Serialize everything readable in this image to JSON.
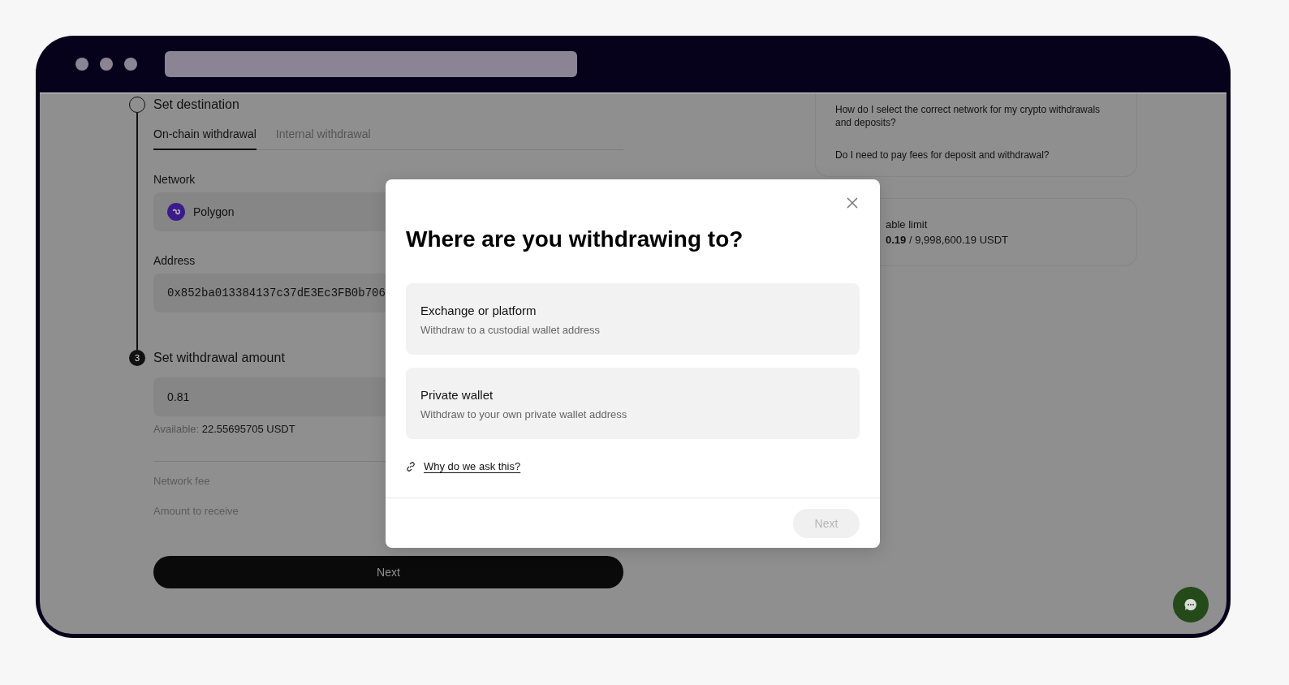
{
  "destination": {
    "title": "Set destination",
    "tabs": [
      {
        "label": "On-chain withdrawal",
        "selected": true
      },
      {
        "label": "Internal withdrawal",
        "selected": false
      }
    ],
    "network": {
      "label": "Network",
      "value": "Polygon"
    },
    "address": {
      "label": "Address",
      "value": "0x852ba013384137c37dE3Ec3FB0b706"
    }
  },
  "amount": {
    "step": "3",
    "title": "Set withdrawal amount",
    "value": "0.81",
    "available_label": "Available:",
    "available_value": "22.55695705 USDT",
    "rows": [
      "Network fee",
      "Amount to receive"
    ],
    "button": "Next"
  },
  "faq": [
    "How do I select the correct network for my crypto withdrawals and deposits?",
    "Do I need to pay fees for deposit and withdrawal?"
  ],
  "limit": {
    "label": "able limit",
    "value": "**0.19** / 9,998,600.19 USDT"
  },
  "modal": {
    "title": "Where are you withdrawing to?",
    "options": [
      {
        "title": "Exchange or platform",
        "description": "Withdraw to a custodial wallet address",
        "selected": false
      },
      {
        "title": "Private wallet",
        "description": "Withdraw to your own private wallet address",
        "selected": false
      }
    ],
    "link": "Why do we ask this?",
    "next": {
      "label": "Next",
      "disabled": true
    }
  }
}
